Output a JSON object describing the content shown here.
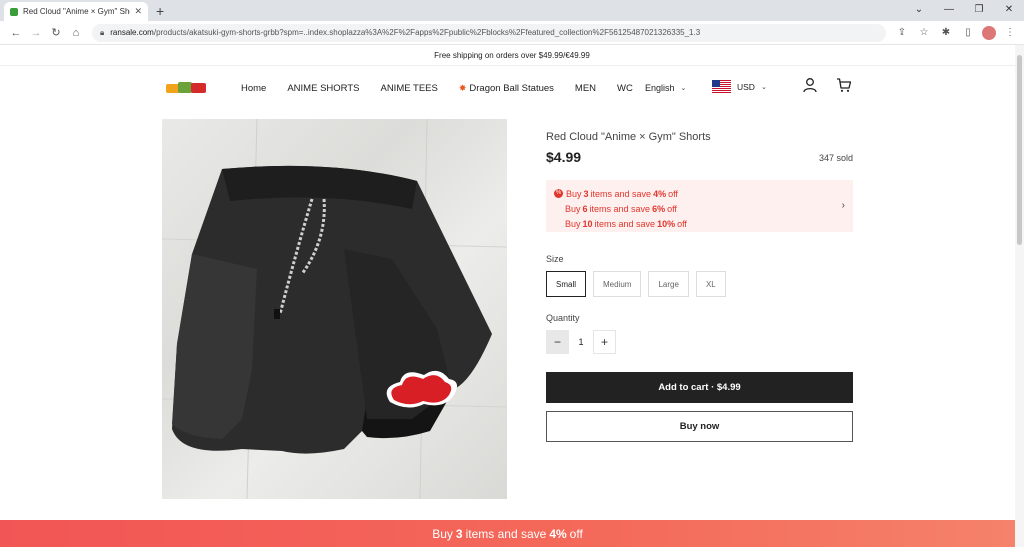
{
  "browser": {
    "tab_title": "Red Cloud \"Anime × Gym\" Shorts",
    "url_host": "ransale.com",
    "url_path": "/products/akatsuki-gym-shorts-grbb?spm=..index.shoplazza%3A%2F%2Fapps%2Fpublic%2Fblocks%2Ffeatured_collection%2F56125487021326335_1.3"
  },
  "announcement": "Free shipping on orders over $49.99/€49.99",
  "nav": {
    "items": [
      "Home",
      "ANIME SHORTS",
      "ANIME TEES",
      "Dragon Ball Statues",
      "MEN",
      "WC"
    ],
    "language": "English",
    "currency": "USD"
  },
  "product": {
    "title": "Red Cloud \"Anime × Gym\" Shorts",
    "price": "$4.99",
    "sold": "347 sold",
    "promo": [
      {
        "prefix": "Buy",
        "qty": "3",
        "mid": "items and save",
        "pct": "4%",
        "suffix": "off"
      },
      {
        "prefix": "Buy",
        "qty": "6",
        "mid": "items and save",
        "pct": "6%",
        "suffix": "off"
      },
      {
        "prefix": "Buy",
        "qty": "10",
        "mid": "items and save",
        "pct": "10%",
        "suffix": "off"
      }
    ],
    "size_label": "Size",
    "sizes": [
      "Small",
      "Medium",
      "Large",
      "XL"
    ],
    "selected_size": "Small",
    "quantity_label": "Quantity",
    "quantity": "1",
    "add_to_cart": "Add to cart · $4.99",
    "buy_now": "Buy now"
  },
  "bottom_bar": {
    "prefix": "Buy",
    "qty": "3",
    "mid": "items and save",
    "pct": "4%",
    "suffix": "off"
  },
  "colors": {
    "accent_red": "#e2352b",
    "promo_bg": "#fdf0ef",
    "dark": "#222222",
    "banner": "#f25555"
  }
}
